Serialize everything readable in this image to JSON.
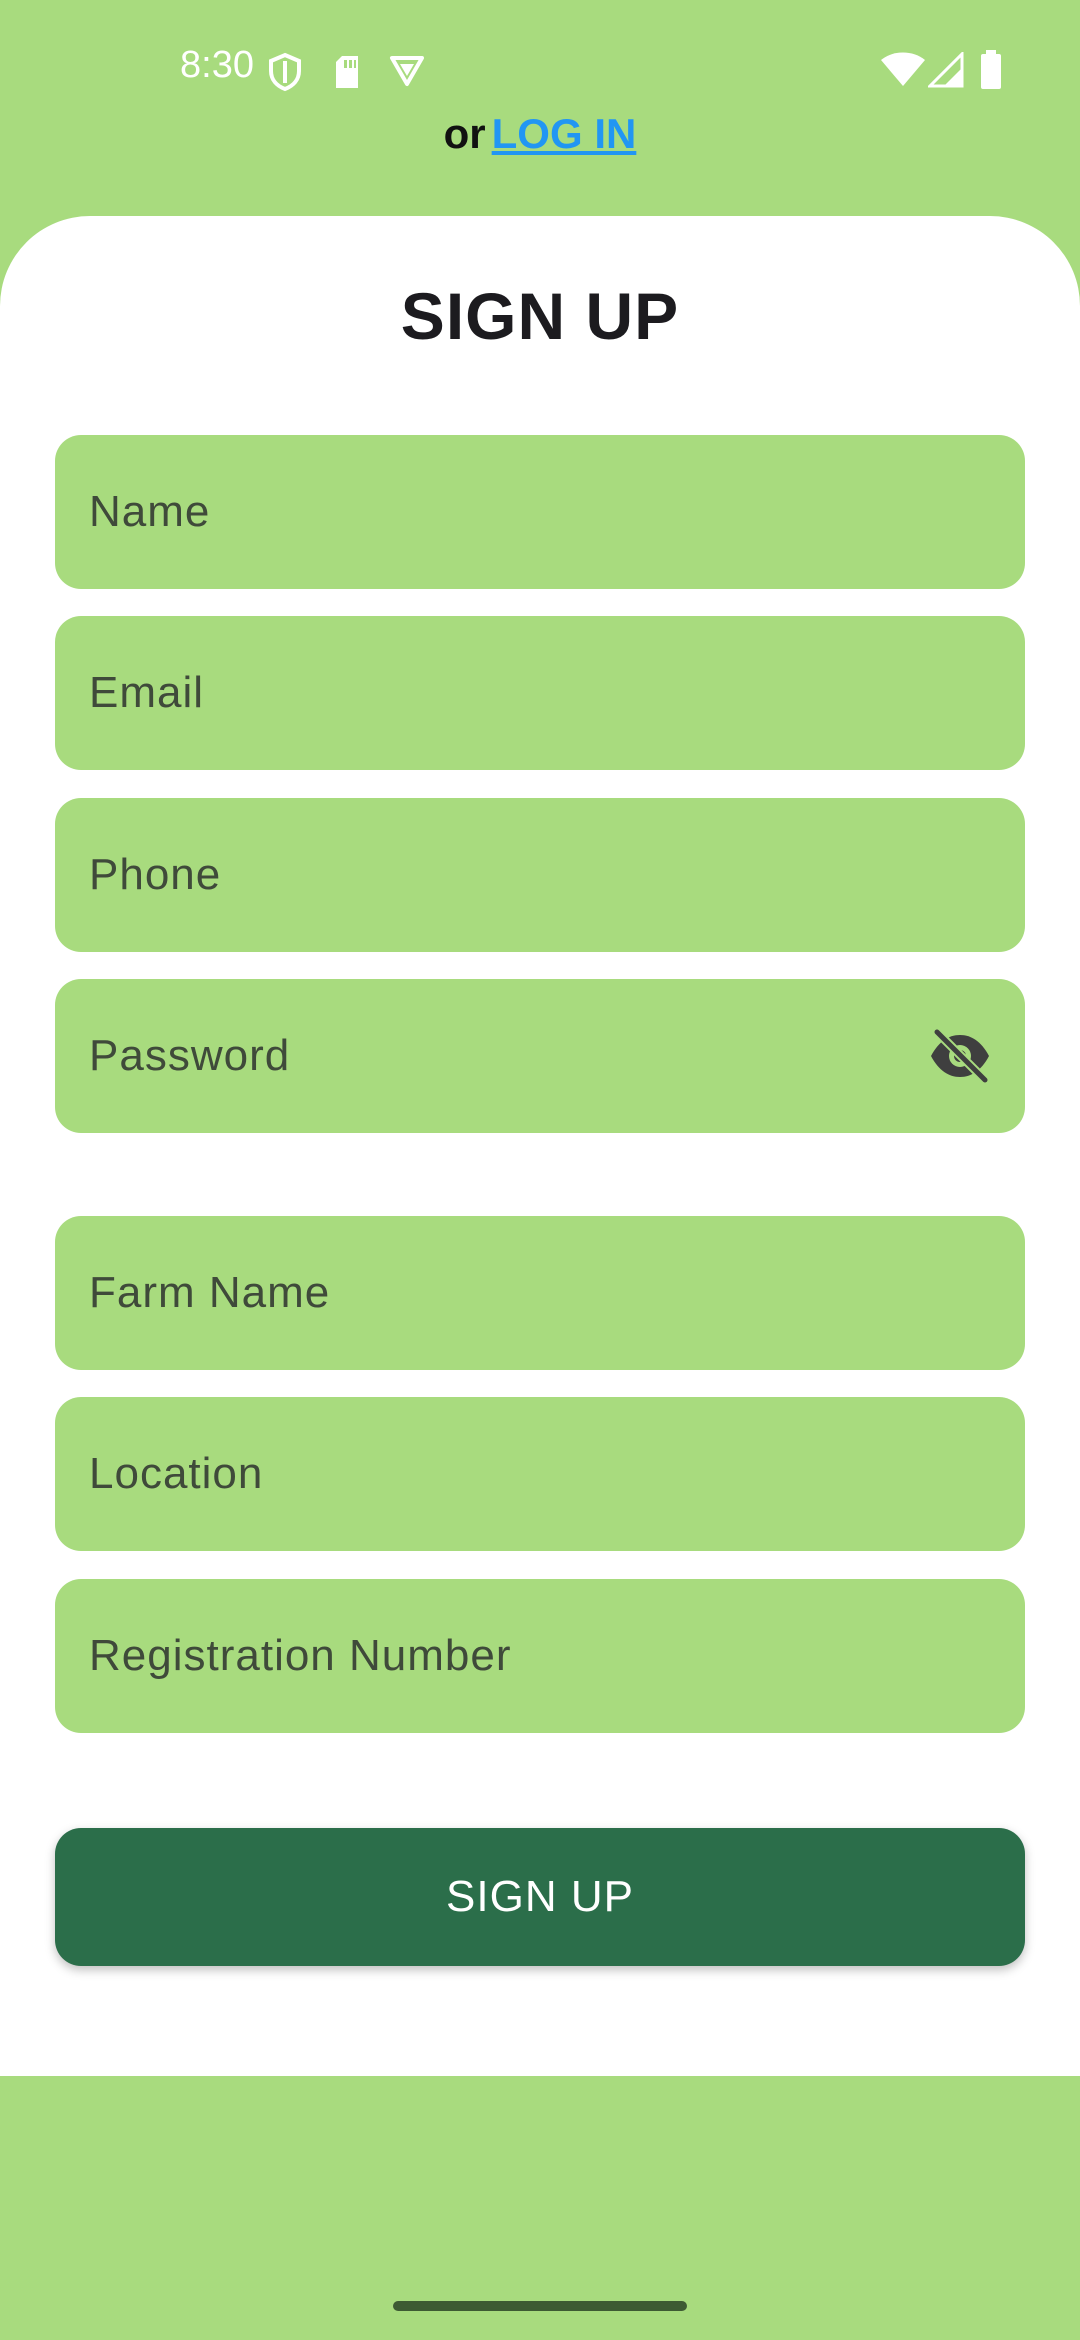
{
  "status_bar": {
    "time": "8:30",
    "icons": [
      "shield-icon",
      "sd-card-icon",
      "vpn-badge-icon",
      "wifi-icon",
      "signal-icon",
      "battery-icon"
    ]
  },
  "login_prompt": {
    "prefix": "or",
    "link_label": "LOG IN"
  },
  "form": {
    "title": "SIGN UP",
    "fields": [
      {
        "label": "Name"
      },
      {
        "label": "Email"
      },
      {
        "label": "Phone"
      },
      {
        "label": "Password"
      },
      {
        "label": "Farm Name"
      },
      {
        "label": "Location"
      },
      {
        "label": "Registration Number"
      }
    ],
    "submit_label": "SIGN UP"
  },
  "colors": {
    "background": "#a8db7e",
    "card": "#ffffff",
    "field": "#a8db7e",
    "button": "#2b6e4a",
    "link": "#2196f3"
  }
}
